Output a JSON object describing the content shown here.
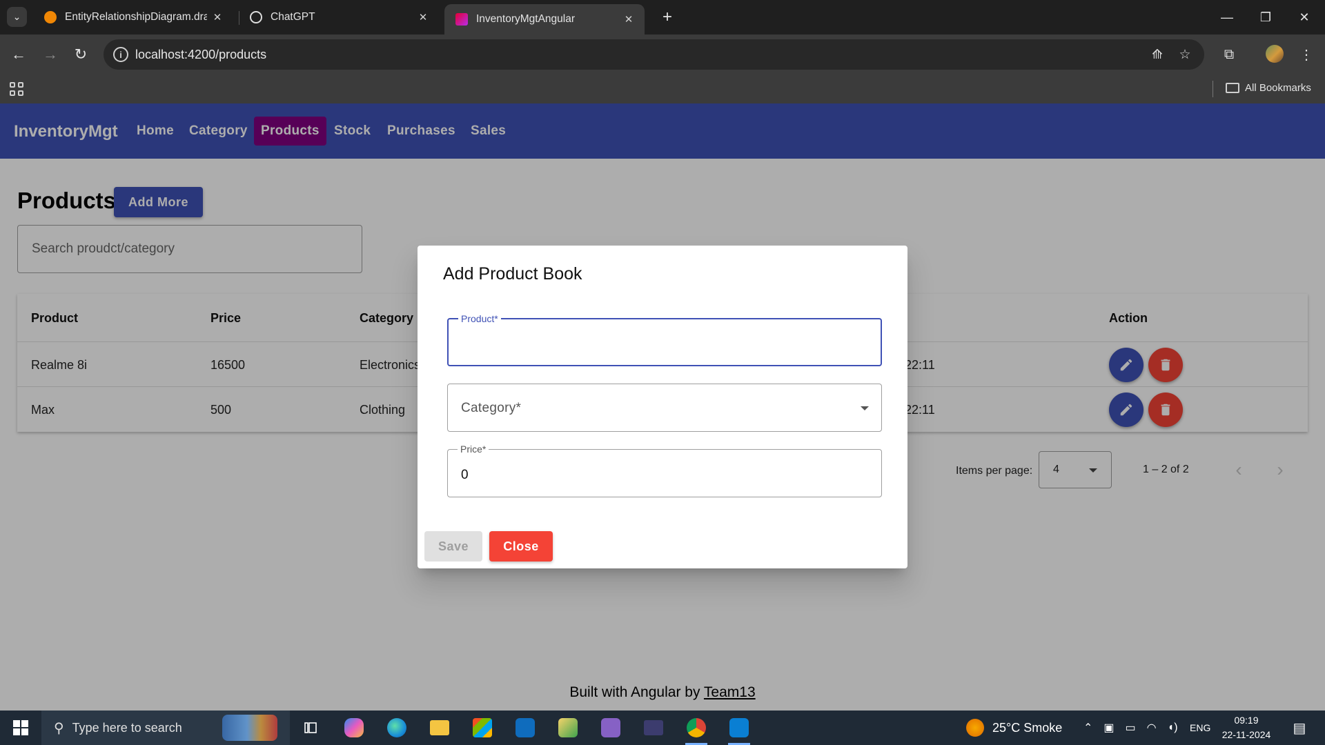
{
  "browser": {
    "tabs": [
      {
        "title": "EntityRelationshipDiagram.draw",
        "active": false
      },
      {
        "title": "ChatGPT",
        "active": false
      },
      {
        "title": "InventoryMgtAngular",
        "active": true
      }
    ],
    "url": "localhost:4200/products",
    "bookmarks_label": "All Bookmarks"
  },
  "nav": {
    "brand": "InventoryMgt",
    "links": [
      "Home",
      "Category",
      "Products",
      "Stock",
      "Purchases",
      "Sales"
    ],
    "active": "Products"
  },
  "page": {
    "title": "Products",
    "add_more_label": "Add More",
    "search_placeholder": "Search proudct/category"
  },
  "table": {
    "headers": {
      "product": "Product",
      "price": "Price",
      "category": "Category",
      "action": "Action"
    },
    "rows": [
      {
        "product": "Realme 8i",
        "price": "16500",
        "category": "Electronics",
        "time": "22:11"
      },
      {
        "product": "Max",
        "price": "500",
        "category": "Clothing",
        "time": "22:11"
      }
    ]
  },
  "paginator": {
    "items_per_page_label": "Items per page:",
    "page_size": "4",
    "range": "1 – 2 of 2"
  },
  "footer": {
    "text": "Built with Angular by",
    "link": "Team13"
  },
  "dialog": {
    "title": "Add Product Book",
    "product_label": "Product*",
    "product_value": "",
    "category_placeholder": "Category*",
    "price_label": "Price*",
    "price_value": "0",
    "save_label": "Save",
    "close_label": "Close"
  },
  "taskbar": {
    "search_placeholder": "Type here to search",
    "weather": "25°C  Smoke",
    "language": "ENG",
    "time": "09:19",
    "date": "22-11-2024"
  },
  "colors": {
    "primary": "#3f51b5",
    "active_nav": "#800080",
    "warn": "#f44336"
  }
}
